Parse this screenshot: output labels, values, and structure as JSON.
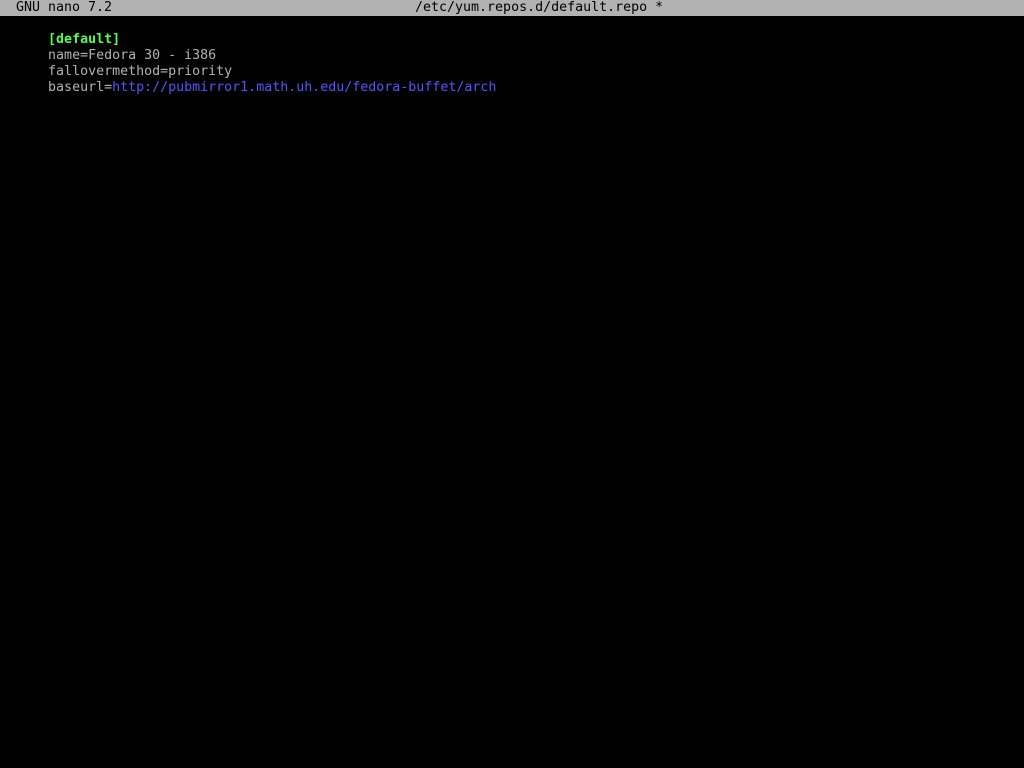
{
  "titlebar": {
    "app_name": "GNU nano 7.2",
    "file_path": "/etc/yum.repos.d/default.repo *"
  },
  "editor": {
    "lines": [
      {
        "text": "[default]",
        "kind": "section"
      },
      {
        "key": "name=",
        "value": "Fedora 30 - i386"
      },
      {
        "key": "fallovermethod=",
        "value": "priority"
      },
      {
        "key": "baseurl=",
        "value": "http://pubmirror1.math.uh.edu/fedora-buffet/arch"
      }
    ]
  },
  "colors": {
    "background": "#000000",
    "titlebar_bg": "#b2b2b2",
    "text": "#b2b2b2",
    "section": "#54fc54",
    "url": "#5454fc"
  }
}
